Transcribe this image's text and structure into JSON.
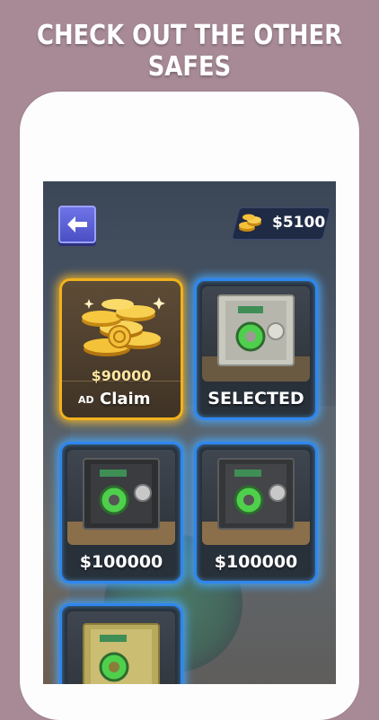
{
  "promo": {
    "title": "CHECK OUT THE OTHER SAFES"
  },
  "header": {
    "back_icon": "arrow-left-icon",
    "coins": "$5100",
    "coin_icon": "gold-coins-icon"
  },
  "shop": {
    "reward_card": {
      "amount": "$90000",
      "ad_label": "AD",
      "claim_label": "Claim"
    },
    "safes": [
      {
        "label": "SELECTED",
        "finish": "silver"
      },
      {
        "label": "$100000",
        "finish": "dark"
      },
      {
        "label": "$100000",
        "finish": "dark"
      },
      {
        "label": "",
        "finish": "gold"
      }
    ]
  },
  "colors": {
    "background": "#a78a96",
    "card_border_blue": "#2f86f0",
    "card_border_gold": "#f2b21c",
    "back_button": "#5a5fd6"
  }
}
